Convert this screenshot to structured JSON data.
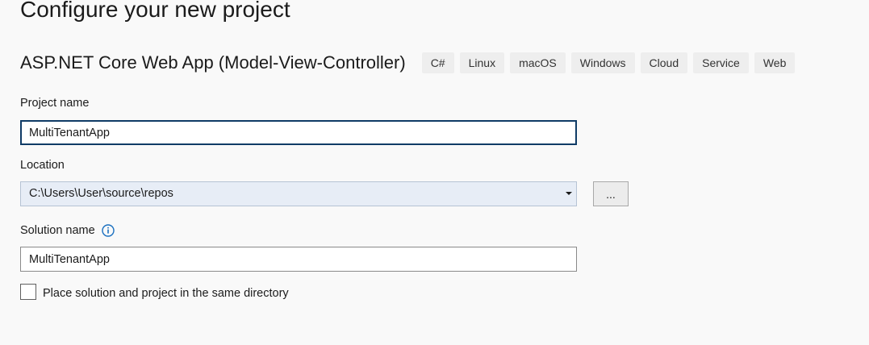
{
  "header": {
    "title": "Configure your new project"
  },
  "template": {
    "name": "ASP.NET Core Web App (Model-View-Controller)",
    "tags": [
      "C#",
      "Linux",
      "macOS",
      "Windows",
      "Cloud",
      "Service",
      "Web"
    ]
  },
  "form": {
    "project_name": {
      "label": "Project name",
      "value": "MultiTenantApp"
    },
    "location": {
      "label": "Location",
      "value": "C:\\Users\\User\\source\\repos",
      "browse_label": "..."
    },
    "solution_name": {
      "label": "Solution name",
      "value": "MultiTenantApp",
      "info_icon": "info-icon"
    },
    "same_directory": {
      "label": "Place solution and project in the same directory",
      "checked": false
    }
  },
  "colors": {
    "background": "#f9f9f9",
    "accent": "#0f3b66",
    "info_icon": "#1a6fbf",
    "tag_background": "#eeeeee"
  }
}
